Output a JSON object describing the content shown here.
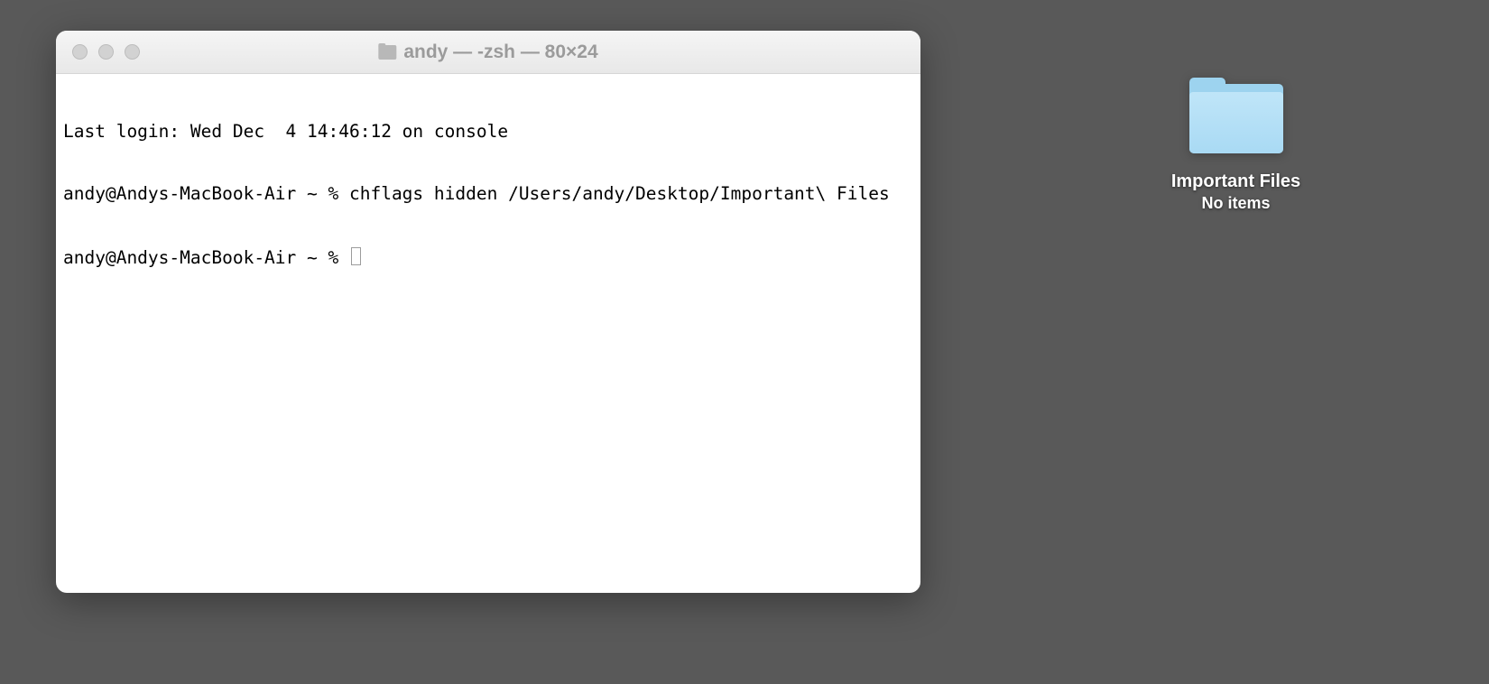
{
  "terminal": {
    "titlebar": {
      "icon": "folder-icon",
      "title": "andy — -zsh — 80×24"
    },
    "lines": {
      "line1": "Last login: Wed Dec  4 14:46:12 on console",
      "line2": "andy@Andys-MacBook-Air ~ % chflags hidden /Users/andy/Desktop/Important\\ Files",
      "prompt": "andy@Andys-MacBook-Air ~ % "
    }
  },
  "desktop": {
    "folder": {
      "name": "Important Files",
      "subtitle": "No items"
    }
  }
}
